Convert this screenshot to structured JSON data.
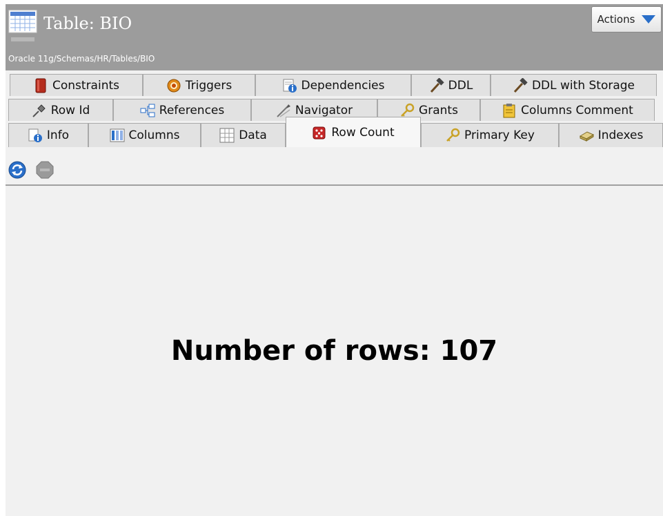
{
  "header": {
    "title": "Table: BIO",
    "path": "Oracle 11g/Schemas/HR/Tables/BIO",
    "actions_label": "Actions"
  },
  "tabs": {
    "row1": [
      {
        "label": "Constraints",
        "icon": "constraints-icon"
      },
      {
        "label": "Triggers",
        "icon": "triggers-icon"
      },
      {
        "label": "Dependencies",
        "icon": "dependencies-icon"
      },
      {
        "label": "DDL",
        "icon": "hammer-icon"
      },
      {
        "label": "DDL with Storage",
        "icon": "hammer-icon"
      }
    ],
    "row2": [
      {
        "label": "Row Id",
        "icon": "pushpin-icon"
      },
      {
        "label": "References",
        "icon": "references-icon"
      },
      {
        "label": "Navigator",
        "icon": "navigator-icon"
      },
      {
        "label": "Grants",
        "icon": "key-icon"
      },
      {
        "label": "Columns Comment",
        "icon": "clipboard-icon"
      }
    ],
    "row3": [
      {
        "label": "Info",
        "icon": "info-icon"
      },
      {
        "label": "Columns",
        "icon": "columns-icon"
      },
      {
        "label": "Data",
        "icon": "grid-icon"
      },
      {
        "label": "Row Count",
        "icon": "dice-icon",
        "active": true
      },
      {
        "label": "Primary Key",
        "icon": "key-icon"
      },
      {
        "label": "Indexes",
        "icon": "indexes-icon"
      }
    ]
  },
  "toolbar": {
    "refresh_icon": "refresh-icon",
    "stop_icon": "stop-icon"
  },
  "main": {
    "row_count_text": "Number of rows: 107"
  },
  "colors": {
    "header_bg": "#9c9c9c",
    "tab_bg": "#e2e2e2",
    "active_tab_bg": "#f7f7f7",
    "content_bg": "#f1f1f1",
    "accent": "#2a6fc9"
  }
}
